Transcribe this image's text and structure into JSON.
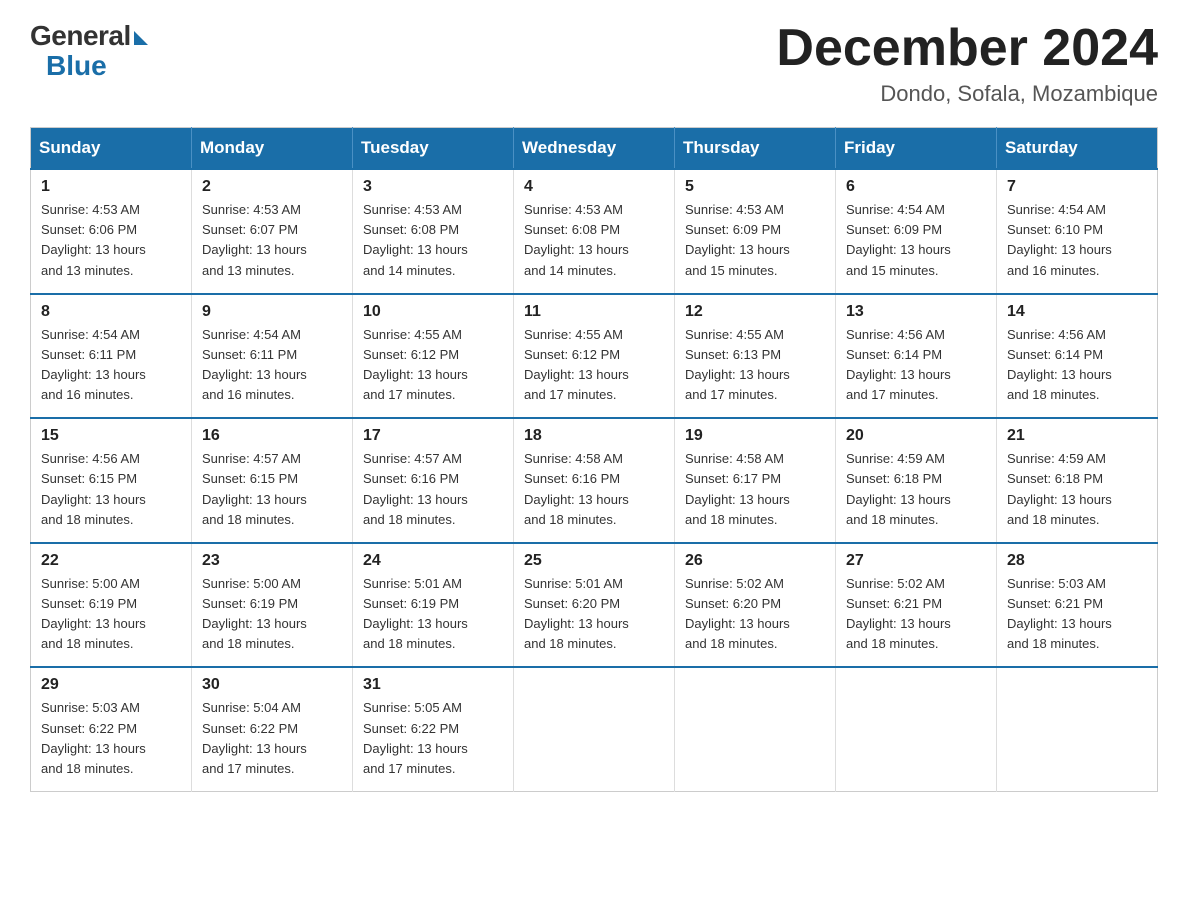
{
  "logo": {
    "general": "General",
    "blue": "Blue",
    "subtitle": "Blue"
  },
  "header": {
    "month_year": "December 2024",
    "location": "Dondo, Sofala, Mozambique"
  },
  "weekdays": [
    "Sunday",
    "Monday",
    "Tuesday",
    "Wednesday",
    "Thursday",
    "Friday",
    "Saturday"
  ],
  "weeks": [
    [
      {
        "day": "1",
        "sunrise": "4:53 AM",
        "sunset": "6:06 PM",
        "daylight": "13 hours and 13 minutes."
      },
      {
        "day": "2",
        "sunrise": "4:53 AM",
        "sunset": "6:07 PM",
        "daylight": "13 hours and 13 minutes."
      },
      {
        "day": "3",
        "sunrise": "4:53 AM",
        "sunset": "6:08 PM",
        "daylight": "13 hours and 14 minutes."
      },
      {
        "day": "4",
        "sunrise": "4:53 AM",
        "sunset": "6:08 PM",
        "daylight": "13 hours and 14 minutes."
      },
      {
        "day": "5",
        "sunrise": "4:53 AM",
        "sunset": "6:09 PM",
        "daylight": "13 hours and 15 minutes."
      },
      {
        "day": "6",
        "sunrise": "4:54 AM",
        "sunset": "6:09 PM",
        "daylight": "13 hours and 15 minutes."
      },
      {
        "day": "7",
        "sunrise": "4:54 AM",
        "sunset": "6:10 PM",
        "daylight": "13 hours and 16 minutes."
      }
    ],
    [
      {
        "day": "8",
        "sunrise": "4:54 AM",
        "sunset": "6:11 PM",
        "daylight": "13 hours and 16 minutes."
      },
      {
        "day": "9",
        "sunrise": "4:54 AM",
        "sunset": "6:11 PM",
        "daylight": "13 hours and 16 minutes."
      },
      {
        "day": "10",
        "sunrise": "4:55 AM",
        "sunset": "6:12 PM",
        "daylight": "13 hours and 17 minutes."
      },
      {
        "day": "11",
        "sunrise": "4:55 AM",
        "sunset": "6:12 PM",
        "daylight": "13 hours and 17 minutes."
      },
      {
        "day": "12",
        "sunrise": "4:55 AM",
        "sunset": "6:13 PM",
        "daylight": "13 hours and 17 minutes."
      },
      {
        "day": "13",
        "sunrise": "4:56 AM",
        "sunset": "6:14 PM",
        "daylight": "13 hours and 17 minutes."
      },
      {
        "day": "14",
        "sunrise": "4:56 AM",
        "sunset": "6:14 PM",
        "daylight": "13 hours and 18 minutes."
      }
    ],
    [
      {
        "day": "15",
        "sunrise": "4:56 AM",
        "sunset": "6:15 PM",
        "daylight": "13 hours and 18 minutes."
      },
      {
        "day": "16",
        "sunrise": "4:57 AM",
        "sunset": "6:15 PM",
        "daylight": "13 hours and 18 minutes."
      },
      {
        "day": "17",
        "sunrise": "4:57 AM",
        "sunset": "6:16 PM",
        "daylight": "13 hours and 18 minutes."
      },
      {
        "day": "18",
        "sunrise": "4:58 AM",
        "sunset": "6:16 PM",
        "daylight": "13 hours and 18 minutes."
      },
      {
        "day": "19",
        "sunrise": "4:58 AM",
        "sunset": "6:17 PM",
        "daylight": "13 hours and 18 minutes."
      },
      {
        "day": "20",
        "sunrise": "4:59 AM",
        "sunset": "6:18 PM",
        "daylight": "13 hours and 18 minutes."
      },
      {
        "day": "21",
        "sunrise": "4:59 AM",
        "sunset": "6:18 PM",
        "daylight": "13 hours and 18 minutes."
      }
    ],
    [
      {
        "day": "22",
        "sunrise": "5:00 AM",
        "sunset": "6:19 PM",
        "daylight": "13 hours and 18 minutes."
      },
      {
        "day": "23",
        "sunrise": "5:00 AM",
        "sunset": "6:19 PM",
        "daylight": "13 hours and 18 minutes."
      },
      {
        "day": "24",
        "sunrise": "5:01 AM",
        "sunset": "6:19 PM",
        "daylight": "13 hours and 18 minutes."
      },
      {
        "day": "25",
        "sunrise": "5:01 AM",
        "sunset": "6:20 PM",
        "daylight": "13 hours and 18 minutes."
      },
      {
        "day": "26",
        "sunrise": "5:02 AM",
        "sunset": "6:20 PM",
        "daylight": "13 hours and 18 minutes."
      },
      {
        "day": "27",
        "sunrise": "5:02 AM",
        "sunset": "6:21 PM",
        "daylight": "13 hours and 18 minutes."
      },
      {
        "day": "28",
        "sunrise": "5:03 AM",
        "sunset": "6:21 PM",
        "daylight": "13 hours and 18 minutes."
      }
    ],
    [
      {
        "day": "29",
        "sunrise": "5:03 AM",
        "sunset": "6:22 PM",
        "daylight": "13 hours and 18 minutes."
      },
      {
        "day": "30",
        "sunrise": "5:04 AM",
        "sunset": "6:22 PM",
        "daylight": "13 hours and 17 minutes."
      },
      {
        "day": "31",
        "sunrise": "5:05 AM",
        "sunset": "6:22 PM",
        "daylight": "13 hours and 17 minutes."
      },
      null,
      null,
      null,
      null
    ]
  ],
  "labels": {
    "sunrise": "Sunrise:",
    "sunset": "Sunset:",
    "daylight": "Daylight:"
  }
}
